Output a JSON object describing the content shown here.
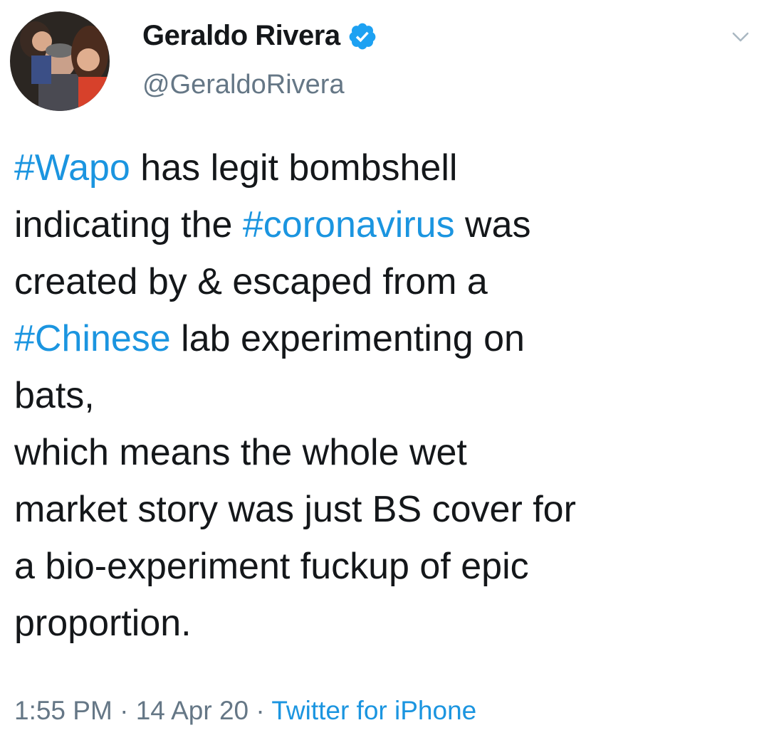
{
  "author": {
    "display_name": "Geraldo Rivera",
    "handle": "@GeraldoRivera",
    "verified": true
  },
  "tweet": {
    "lines": [
      [
        {
          "text": "#Wapo",
          "hashtag": true
        },
        {
          "text": " has legit bombshell",
          "hashtag": false
        }
      ],
      [
        {
          "text": "indicating the ",
          "hashtag": false
        },
        {
          "text": "#coronavirus",
          "hashtag": true
        },
        {
          "text": " was",
          "hashtag": false
        }
      ],
      [
        {
          "text": "created by & escaped from a",
          "hashtag": false
        }
      ],
      [
        {
          "text": "#Chinese",
          "hashtag": true
        },
        {
          "text": " lab experimenting on",
          "hashtag": false
        }
      ],
      [
        {
          "text": "bats,",
          "hashtag": false
        }
      ],
      [
        {
          "text": "which means the whole wet",
          "hashtag": false
        }
      ],
      [
        {
          "text": "market story was just BS cover for",
          "hashtag": false
        }
      ],
      [
        {
          "text": "a bio-experiment fuckup of epic",
          "hashtag": false
        }
      ],
      [
        {
          "text": "proportion.",
          "hashtag": false
        }
      ]
    ]
  },
  "meta": {
    "time": "1:55 PM",
    "separator": " · ",
    "date": "14 Apr 20",
    "source": "Twitter for iPhone"
  },
  "colors": {
    "hashtag": "#1b95e0",
    "verified_badge": "#1da1f2",
    "secondary_text": "#657786"
  },
  "icons": {
    "verified": "verified-badge-icon",
    "menu": "chevron-down-icon"
  }
}
